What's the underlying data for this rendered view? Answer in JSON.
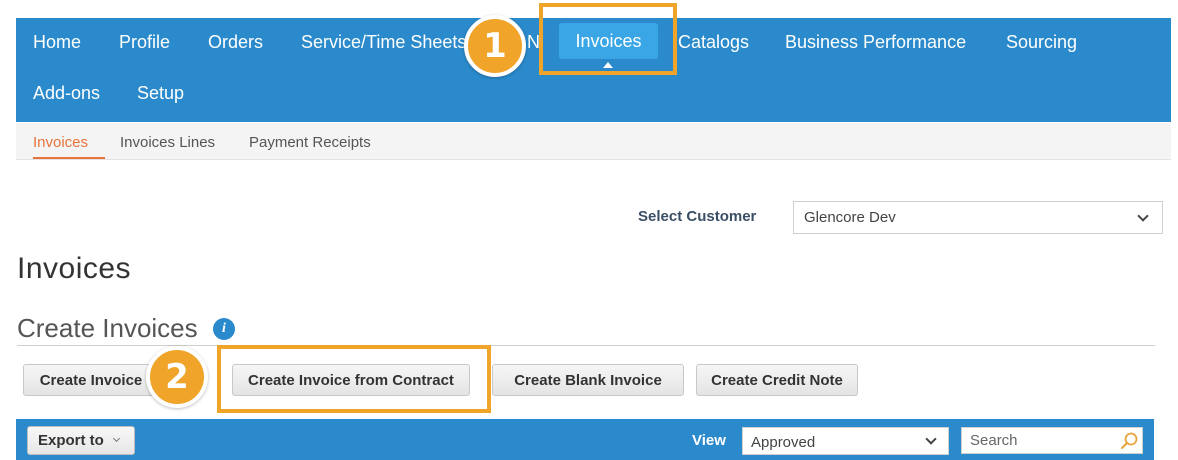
{
  "topnav": {
    "items": [
      "Home",
      "Profile",
      "Orders",
      "Service/Time Sheets",
      "N",
      "Invoices",
      "Catalogs",
      "Business Performance",
      "Sourcing",
      "Add-ons",
      "Setup"
    ]
  },
  "callouts": {
    "step1": "1",
    "step2": "2"
  },
  "subnav": {
    "items": [
      "Invoices",
      "Invoices Lines",
      "Payment Receipts"
    ]
  },
  "customer": {
    "label": "Select Customer",
    "value": "Glencore Dev"
  },
  "page": {
    "title": "Invoices",
    "section_title": "Create Invoices"
  },
  "buttons": {
    "create_invoice": "Create Invoice",
    "create_from_contract": "Create Invoice from Contract",
    "create_blank": "Create Blank Invoice",
    "create_credit_note": "Create Credit Note"
  },
  "table_bar": {
    "export_label": "Export to",
    "view_label": "View",
    "view_value": "Approved",
    "search_placeholder": "Search"
  },
  "colors": {
    "nav_blue": "#2b8acb",
    "nav_active": "#3aa6e6",
    "highlight_orange": "#f0a42a",
    "subnav_active": "#e8743b"
  }
}
